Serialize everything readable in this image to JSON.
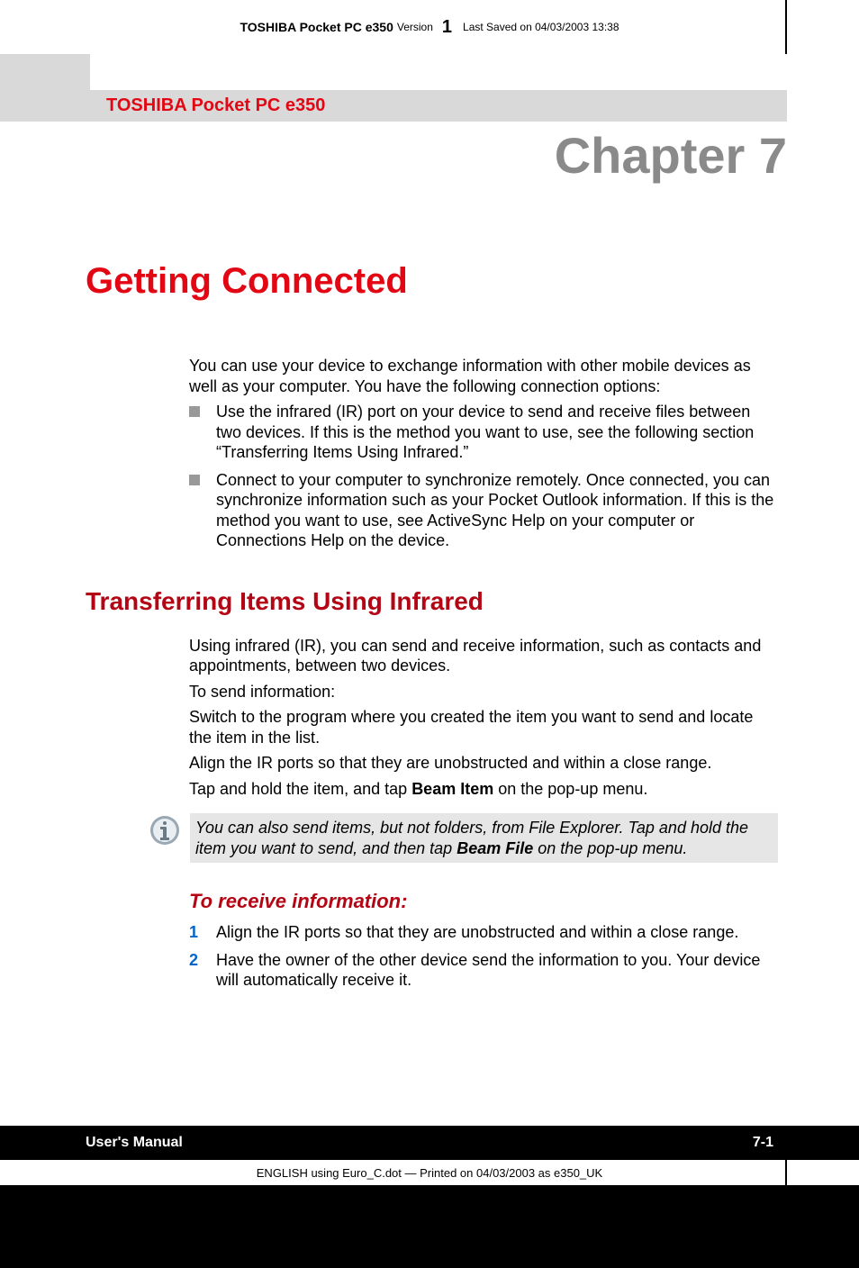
{
  "header": {
    "product_bold": "TOSHIBA Pocket PC e350",
    "version_label": "Version",
    "version_num": "1",
    "saved": "Last Saved on 04/03/2003 13:38"
  },
  "band": {
    "product": "TOSHIBA Pocket PC e350"
  },
  "chapter": "Chapter 7",
  "h1": "Getting Connected",
  "intro": "You can use your device to exchange information with other mobile devices as well as your computer. You have the following connection options:",
  "bullets": [
    "Use the infrared (IR) port on your device to send and receive files between two devices. If this is the method you want to use, see the following section “Transferring Items Using Infrared.”",
    "Connect to your computer to synchronize remotely. Once connected, you can synchronize information such as your Pocket Outlook information. If this is the method you want to use, see ActiveSync Help on your computer or Connections Help on the device."
  ],
  "h2": "Transferring Items Using Infrared",
  "p1": "Using infrared (IR), you can send and receive information, such as contacts and appointments, between two devices.",
  "p2": "To send information:",
  "p3": "Switch to the program where you created the item you want to send and locate the item in the list.",
  "p4": "Align the IR ports so that they are unobstructed and within a close range.",
  "p5_pre": "Tap and hold the item, and tap ",
  "p5_bold": "Beam Item",
  "p5_post": " on the pop-up menu.",
  "note_pre": "You can also send items, but not folders, from File Explorer. Tap and hold the item you want to send, and then tap ",
  "note_bold": "Beam File",
  "note_post": " on the pop-up menu.",
  "h3": "To receive information:",
  "steps": [
    {
      "num": "1",
      "text": "Align the IR ports so that they are unobstructed and within a close range."
    },
    {
      "num": "2",
      "text": "Have the owner of the other device send the information to you. Your device will automatically receive it."
    }
  ],
  "footer": {
    "left": "User's Manual",
    "right": "7-1",
    "print": "ENGLISH using  Euro_C.dot — Printed on 04/03/2003 as e350_UK"
  }
}
